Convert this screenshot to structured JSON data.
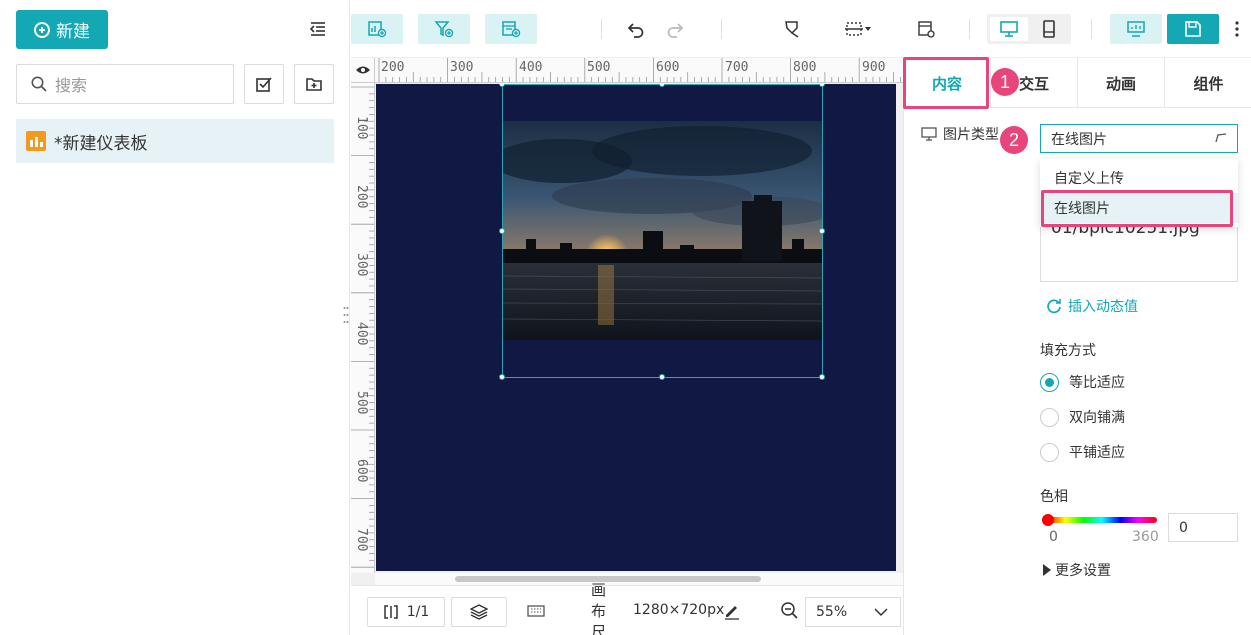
{
  "left_panel": {
    "new_button_label": "新建",
    "search_placeholder": "搜索",
    "tree_items": [
      {
        "label": "*新建仪表板"
      }
    ]
  },
  "toolbar": {
    "icons": [
      "add-chart-icon",
      "add-filter-icon",
      "add-table-icon",
      "undo-icon",
      "redo-icon",
      "brush-icon",
      "align-icon",
      "settings-icon",
      "desktop-icon",
      "mobile-icon",
      "preview-icon",
      "save-icon",
      "more-icon"
    ],
    "accent_color": "#13a8b3"
  },
  "rulers": {
    "top_labels": [
      "200",
      "300",
      "400",
      "500",
      "600",
      "700",
      "800",
      "900"
    ],
    "left_labels": [
      "100",
      "200",
      "300",
      "400",
      "500",
      "600",
      "700"
    ]
  },
  "bottom_bar": {
    "page_indicator": "1/1",
    "canvas_size_label": "画布尺寸:",
    "canvas_size_value": "1280×720px",
    "zoom_value": "55%"
  },
  "right_panel": {
    "tabs": [
      {
        "label": "内容",
        "active": true
      },
      {
        "label": "交互",
        "active": false
      },
      {
        "label": "动画",
        "active": false
      },
      {
        "label": "组件",
        "active": false
      }
    ],
    "image_type_label": "图片类型",
    "image_type_value": "在线图片",
    "dropdown_options": [
      "自定义上传",
      "在线图片"
    ],
    "url_partial_text": "01/bpic10251.jpg",
    "insert_dynamic_label": "插入动态值",
    "fill_mode_label": "填充方式",
    "fill_options": [
      {
        "label": "等比适应",
        "checked": true
      },
      {
        "label": "双向铺满",
        "checked": false
      },
      {
        "label": "平铺适应",
        "checked": false
      }
    ],
    "hue_label": "色相",
    "hue_min": "0",
    "hue_max": "360",
    "hue_value": "0",
    "more_settings_label": "更多设置"
  },
  "annotations": {
    "step1": "1",
    "step2": "2",
    "highlight_color": "#e8467a"
  }
}
